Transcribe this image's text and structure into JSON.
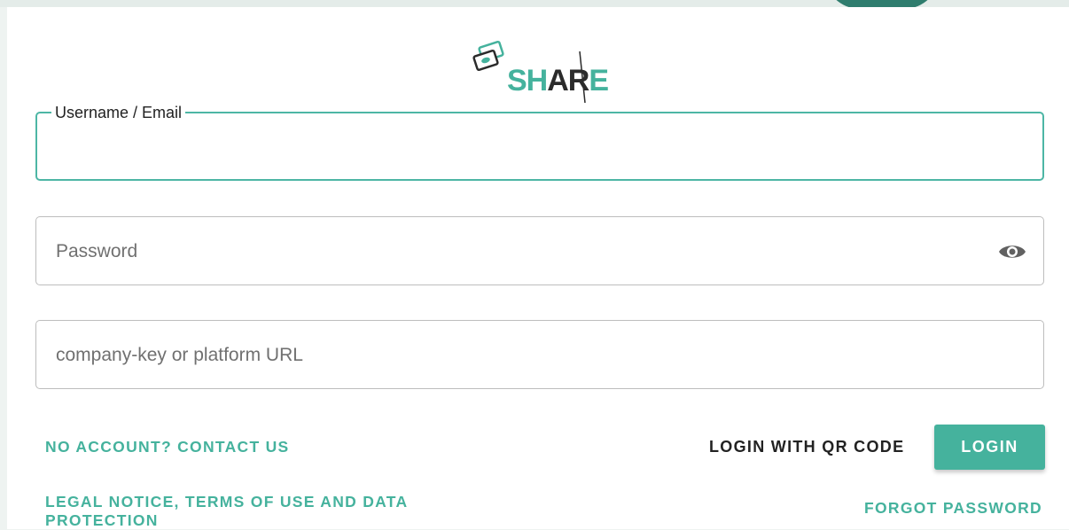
{
  "brand": {
    "logo_text_primary": "SH",
    "logo_text_accent": "AR",
    "logo_text_end": "E",
    "logo_icon": "camera-cards-icon",
    "primary_color": "#45b29d",
    "focus_color": "#4db6a5",
    "dark_accent_color": "#2f7d6e"
  },
  "form": {
    "username_label": "Username / Email",
    "username_value": "",
    "password_placeholder": "Password",
    "password_value": "",
    "password_toggle_icon": "eye-icon",
    "company_placeholder": "company-key or platform URL",
    "company_value": ""
  },
  "actions": {
    "contact_link": "NO ACCOUNT? CONTACT US",
    "qr_login": "LOGIN WITH QR CODE",
    "login": "LOGIN",
    "legal_link": "LEGAL NOTICE, TERMS OF USE AND DATA PROTECTION",
    "forgot_password": "FORGOT PASSWORD"
  }
}
